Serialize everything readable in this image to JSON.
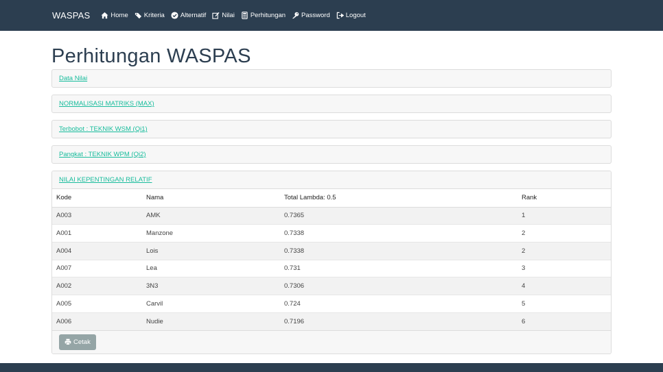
{
  "navbar": {
    "brand": "WASPAS",
    "items": [
      {
        "label": "Home",
        "icon": "home-icon"
      },
      {
        "label": "Kriteria",
        "icon": "tags-icon"
      },
      {
        "label": "Alternatif",
        "icon": "check-circle-icon"
      },
      {
        "label": "Nilai",
        "icon": "edit-icon"
      },
      {
        "label": "Perhitungan",
        "icon": "calculator-icon"
      },
      {
        "label": "Password",
        "icon": "key-icon"
      },
      {
        "label": "Logout",
        "icon": "sign-out-icon"
      }
    ]
  },
  "main": {
    "title": "Perhitungan WASPAS",
    "panels": [
      {
        "label": "Data Nilai"
      },
      {
        "label": "NORMALISASI MATRIKS (MAX)"
      },
      {
        "label": "Terbobot : TEKNIK WSM (Qi1)"
      },
      {
        "label": "Pangkat : TEKNIK WPM (Qi2)"
      }
    ],
    "result_panel": {
      "label": "NILAI KEPENTINGAN RELATIF",
      "columns": [
        "Kode",
        "Nama",
        "Total Lambda: 0.5",
        "Rank"
      ],
      "rows": [
        [
          "A003",
          "AMK",
          "0.7365",
          "1"
        ],
        [
          "A001",
          "Manzone",
          "0.7338",
          "2"
        ],
        [
          "A004",
          "Lois",
          "0.7338",
          "2"
        ],
        [
          "A007",
          "Lea",
          "0.731",
          "3"
        ],
        [
          "A002",
          "3N3",
          "0.7306",
          "4"
        ],
        [
          "A005",
          "Carvil",
          "0.724",
          "5"
        ],
        [
          "A006",
          "Nudie",
          "0.7196",
          "6"
        ]
      ],
      "print_label": "Cetak"
    }
  },
  "colors": {
    "navbar": "#2c3e50",
    "link": "#18bc9c",
    "print_button": "#95a5a6"
  }
}
